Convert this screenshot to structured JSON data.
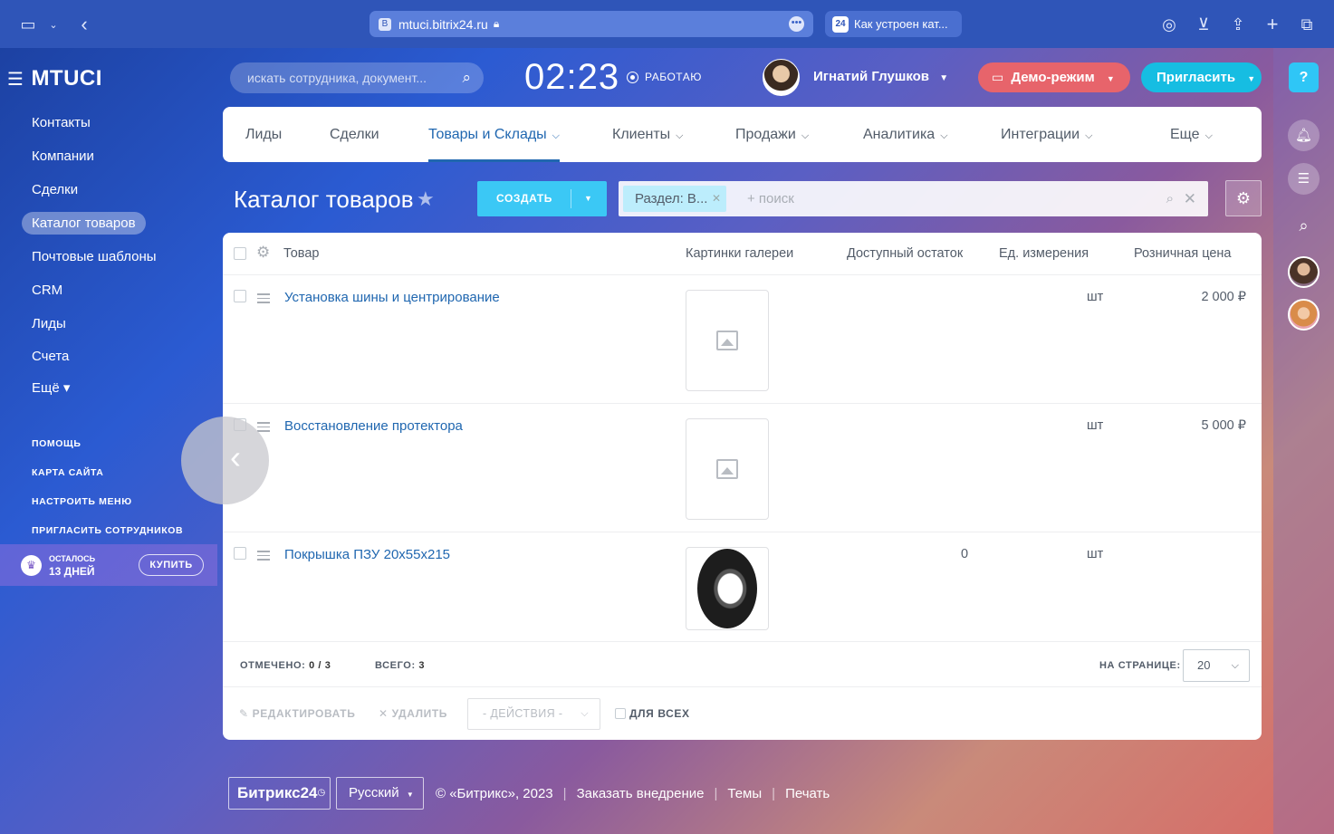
{
  "browser": {
    "url": "mtuci.bitrix24.ru",
    "url_favicon": "B",
    "tab_title": "Как устроен кат...",
    "tab_favicon": "24"
  },
  "sidebar": {
    "logo": "MTUCI",
    "items": [
      {
        "label": "Контакты"
      },
      {
        "label": "Компании"
      },
      {
        "label": "Сделки"
      },
      {
        "label": "Каталог товаров",
        "active": true
      },
      {
        "label": "Почтовые шаблоны"
      },
      {
        "label": "CRM"
      },
      {
        "label": "Лиды"
      },
      {
        "label": "Счета"
      },
      {
        "label": "Ещё ▾"
      }
    ],
    "links": [
      "ПОМОЩЬ",
      "КАРТА САЙТА",
      "НАСТРОИТЬ МЕНЮ",
      "ПРИГЛАСИТЬ СОТРУДНИКОВ"
    ],
    "trial": {
      "line1": "ОСТАЛОСЬ",
      "line2": "13 ДНЕЙ",
      "buy": "КУПИТЬ"
    }
  },
  "header": {
    "search_placeholder": "искать сотрудника, документ...",
    "clock": "02:23",
    "work_status": "РАБОТАЮ",
    "user_name": "Игнатий Глушков",
    "demo_label": "Демо-режим",
    "invite_label": "Пригласить"
  },
  "tabs": [
    {
      "label": "Лиды"
    },
    {
      "label": "Сделки"
    },
    {
      "label": "Товары и Склады",
      "active": true
    },
    {
      "label": "Клиенты"
    },
    {
      "label": "Продажи"
    },
    {
      "label": "Аналитика"
    },
    {
      "label": "Интеграции"
    },
    {
      "label": "Еще"
    }
  ],
  "catalog": {
    "title": "Каталог товаров",
    "create_label": "СОЗДАТЬ",
    "filter_tag": "Раздел: В...",
    "filter_placeholder": "+ поиск"
  },
  "grid": {
    "columns": [
      "Товар",
      "Картинки галереи",
      "Доступный остаток",
      "Ед. измерения",
      "Розничная цена"
    ],
    "rows": [
      {
        "name": "Установка шины и центрирование",
        "image": "placeholder",
        "stock": "",
        "unit": "шт",
        "price": "2 000 ₽"
      },
      {
        "name": "Восстановление протектора",
        "image": "placeholder",
        "stock": "",
        "unit": "шт",
        "price": "5 000 ₽"
      },
      {
        "name": "Покрышка ПЗУ 20х55х215",
        "image": "tire",
        "stock": "0",
        "unit": "шт",
        "price": ""
      }
    ],
    "footer": {
      "selected_label": "ОТМЕЧЕНО:",
      "selected_value": "0 / 3",
      "total_label": "ВСЕГО:",
      "total_value": "3",
      "per_page_label": "НА СТРАНИЦЕ:",
      "per_page_value": "20"
    },
    "actions": {
      "edit": "РЕДАКТИРОВАТЬ",
      "delete": "УДАЛИТЬ",
      "actions_select": "- ДЕЙСТВИЯ -",
      "for_all": "ДЛЯ ВСЕХ"
    }
  },
  "footer": {
    "brand": "Битрикс24",
    "language": "Русский",
    "links": [
      "© «Битрикс», 2023",
      "Заказать внедрение",
      "Темы",
      "Печать"
    ]
  },
  "colors": {
    "accent": "#2067b0",
    "create_button": "#3bc8f5",
    "demo_button": "#e7646b",
    "invite_button": "#16bde2"
  }
}
